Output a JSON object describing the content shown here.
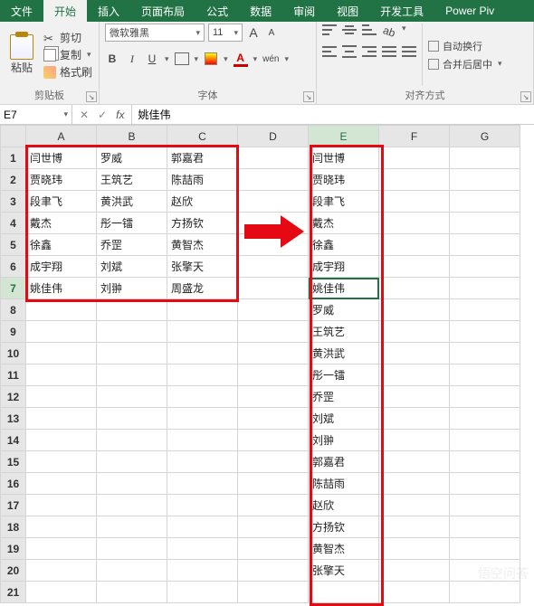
{
  "menubar": {
    "tabs": [
      "文件",
      "开始",
      "插入",
      "页面布局",
      "公式",
      "数据",
      "审阅",
      "视图",
      "开发工具",
      "Power Piv"
    ],
    "active_index": 1
  },
  "ribbon": {
    "clipboard": {
      "paste": "粘贴",
      "cut": "剪切",
      "copy": "复制",
      "format_painter": "格式刷",
      "group_label": "剪贴板"
    },
    "font": {
      "name": "微软雅黑",
      "size": "11",
      "bold": "B",
      "italic": "I",
      "underline": "U",
      "grow": "A",
      "shrink": "A",
      "phonetic": "wén",
      "group_label": "字体"
    },
    "alignment": {
      "wrap_text": "自动换行",
      "merge_center": "合并后居中",
      "group_label": "对齐方式"
    }
  },
  "namebox": {
    "ref": "E7"
  },
  "formula": {
    "value": "姚佳伟"
  },
  "columns": [
    "A",
    "B",
    "C",
    "D",
    "E",
    "F",
    "G"
  ],
  "cells": {
    "A": [
      "闫世博",
      "贾晓玮",
      "段聿飞",
      "戴杰",
      "徐鑫",
      "成宇翔",
      "姚佳伟"
    ],
    "B": [
      "罗威",
      "王筑艺",
      "黄洪武",
      "彤一镭",
      "乔罡",
      "刘斌",
      "刘翀"
    ],
    "C": [
      "郭嘉君",
      "陈喆雨",
      "赵欣",
      "方扬钦",
      "黄智杰",
      "张擎天",
      "周盛龙"
    ],
    "E": [
      "闫世博",
      "贾晓玮",
      "段聿飞",
      "戴杰",
      "徐鑫",
      "成宇翔",
      "姚佳伟",
      "罗威",
      "王筑艺",
      "黄洪武",
      "彤一镭",
      "乔罡",
      "刘斌",
      "刘翀",
      "郭嘉君",
      "陈喆雨",
      "赵欣",
      "方扬钦",
      "黄智杰",
      "张擎天"
    ]
  },
  "row_count": 21,
  "active_cell": "E7",
  "watermark": "悟空问答"
}
